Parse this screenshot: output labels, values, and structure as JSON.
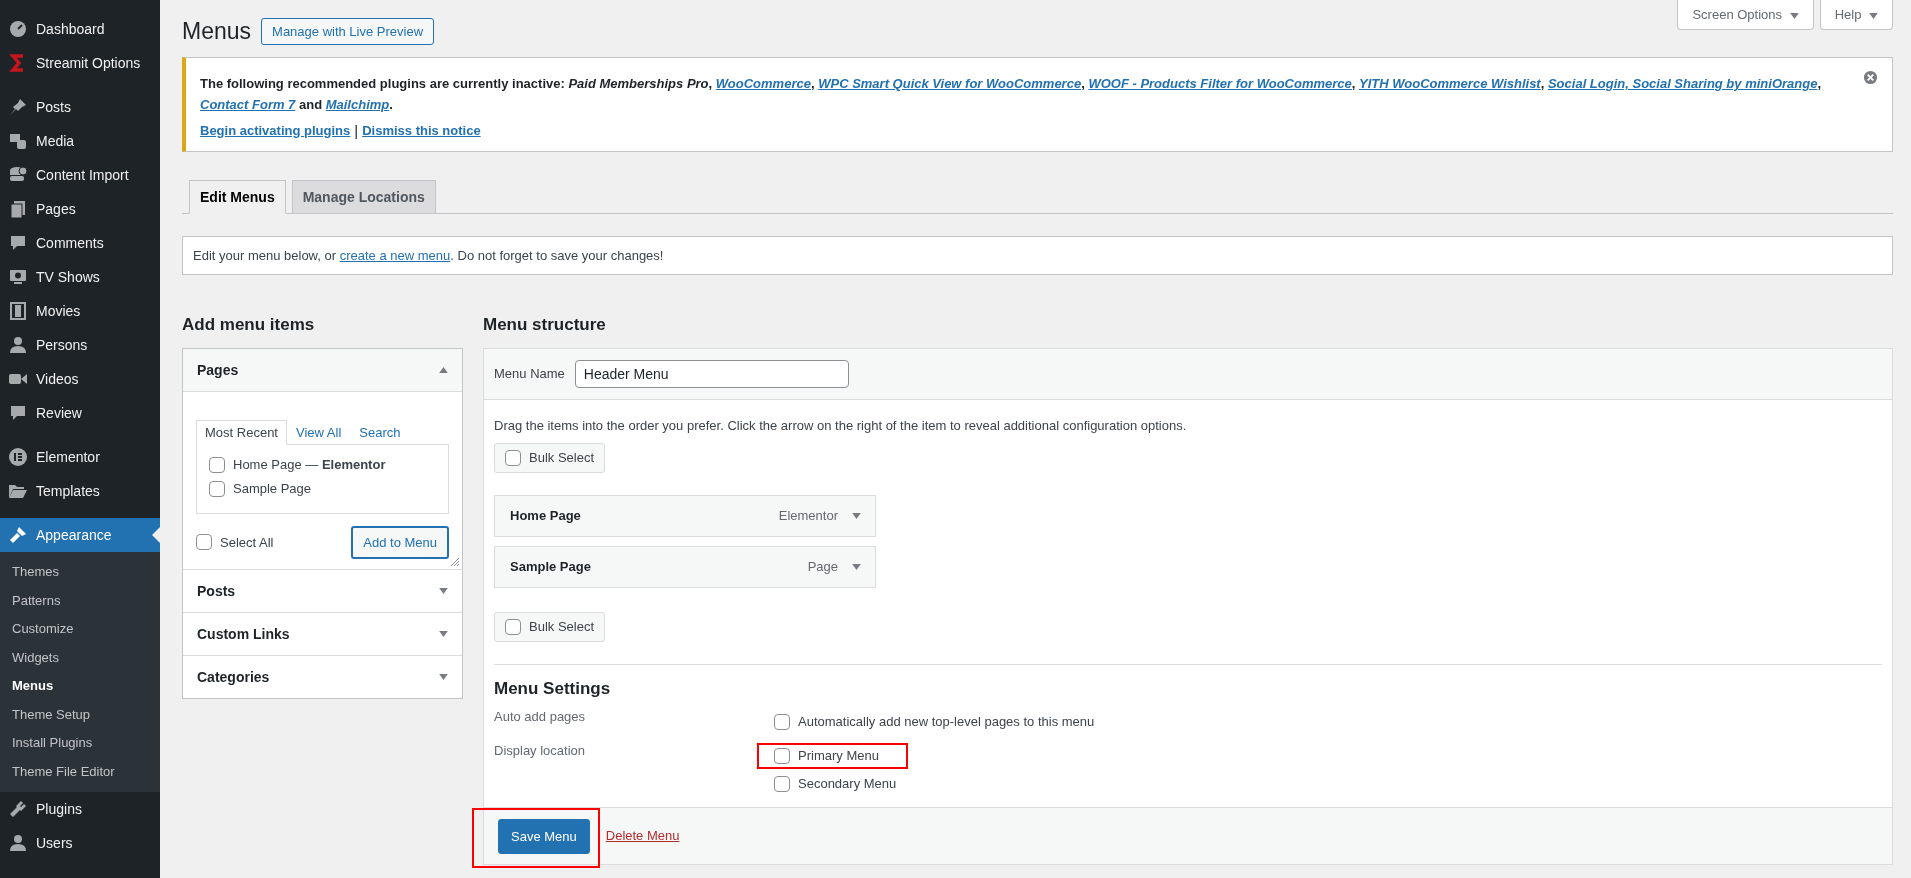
{
  "sidebar": {
    "groups": [
      {
        "items": [
          {
            "label": "Dashboard",
            "selected": false
          },
          {
            "label": "Streamit Options",
            "selected": false
          }
        ]
      },
      {
        "items": [
          {
            "label": "Posts",
            "selected": false
          },
          {
            "label": "Media",
            "selected": false
          },
          {
            "label": "Content Import",
            "selected": false
          },
          {
            "label": "Pages",
            "selected": false
          },
          {
            "label": "Comments",
            "selected": false
          },
          {
            "label": "TV Shows",
            "selected": false
          },
          {
            "label": "Movies",
            "selected": false
          },
          {
            "label": "Persons",
            "selected": false
          },
          {
            "label": "Videos",
            "selected": false
          },
          {
            "label": "Review",
            "selected": false
          }
        ]
      },
      {
        "items": [
          {
            "label": "Elementor",
            "selected": false
          },
          {
            "label": "Templates",
            "selected": false
          }
        ]
      },
      {
        "items": [
          {
            "label": "Appearance",
            "selected": true,
            "submenu": [
              {
                "label": "Themes",
                "selected": false
              },
              {
                "label": "Patterns",
                "selected": false
              },
              {
                "label": "Customize",
                "selected": false
              },
              {
                "label": "Widgets",
                "selected": false
              },
              {
                "label": "Menus",
                "selected": true
              },
              {
                "label": "Theme Setup",
                "selected": false
              },
              {
                "label": "Install Plugins",
                "selected": false
              },
              {
                "label": "Theme File Editor",
                "selected": false
              }
            ]
          },
          {
            "label": "Plugins",
            "selected": false
          },
          {
            "label": "Users",
            "selected": false
          }
        ]
      }
    ]
  },
  "top_buttons": [
    "Screen Options",
    "Help"
  ],
  "page_title": "Menus",
  "live_preview_button": "Manage with Live Preview",
  "notice": {
    "lead": "The following recommended plugins are currently inactive:",
    "plugins": [
      {
        "name": "Paid Memberships Pro",
        "link": false,
        "after": ","
      },
      {
        "name": "WooCommerce",
        "link": true,
        "after": ","
      },
      {
        "name": "WPC Smart Quick View for WooCommerce",
        "link": true,
        "after": ","
      },
      {
        "name": "WOOF - Products Filter for WooCommerce",
        "link": true,
        "after": ","
      },
      {
        "name": "YITH WooCommerce Wishlist",
        "link": true,
        "after": ","
      },
      {
        "name": "Social Login, Social Sharing by miniOrange",
        "link": true,
        "after": ","
      },
      {
        "name": "Contact Form 7",
        "link": true,
        "after": " and"
      },
      {
        "name": "Mailchimp",
        "link": true,
        "after": "."
      }
    ],
    "actions": [
      {
        "label": "Begin activating plugins",
        "separator": "|"
      },
      {
        "label": "Dismiss this notice"
      }
    ]
  },
  "tabs": [
    {
      "label": "Edit Menus",
      "selected": true
    },
    {
      "label": "Manage Locations",
      "selected": false
    }
  ],
  "info": {
    "before": "Edit your menu below, or",
    "link": "create a new menu",
    "after": ". Do not forget to save your changes!"
  },
  "add_items": {
    "heading": "Add menu items",
    "sections": [
      {
        "title": "Pages",
        "expanded": true,
        "tabs": [
          {
            "label": "Most Recent",
            "selected": true
          },
          {
            "label": "View All",
            "selected": false
          },
          {
            "label": "Search",
            "selected": false
          }
        ],
        "items": [
          {
            "label": "Home Page — **Elementor**",
            "checked": false
          },
          {
            "label": "Sample Page",
            "checked": false
          }
        ],
        "select_all": {
          "label": "Select All",
          "checked": false
        },
        "add_button": "Add to Menu"
      },
      {
        "title": "Posts",
        "expanded": false
      },
      {
        "title": "Custom Links",
        "expanded": false
      },
      {
        "title": "Categories",
        "expanded": false
      }
    ]
  },
  "structure": {
    "heading": "Menu structure",
    "name_label": "Menu Name",
    "name_value": "Header Menu",
    "instructions": "Drag the items into the order you prefer. Click the arrow on the right of the item to reveal additional configuration options.",
    "bulk_select": [
      {
        "label": "Bulk Select",
        "checked": false
      },
      {
        "label": "Bulk Select",
        "checked": false
      }
    ],
    "items": [
      {
        "title": "Home Page",
        "type": "Elementor"
      },
      {
        "title": "Sample Page",
        "type": "Page"
      }
    ],
    "settings_heading": "Menu Settings",
    "settings": [
      {
        "label": "Auto add pages",
        "options": [
          {
            "label": "Automatically add new top-level pages to this menu",
            "checked": false,
            "highlighted": false
          }
        ]
      },
      {
        "label": "Display location",
        "options": [
          {
            "label": "Primary Menu",
            "checked": false,
            "highlighted": true
          },
          {
            "label": "Secondary Menu",
            "checked": false,
            "highlighted": false
          }
        ]
      }
    ],
    "save_button": {
      "label": "Save Menu",
      "highlighted": true
    },
    "delete_link": "Delete Menu"
  }
}
